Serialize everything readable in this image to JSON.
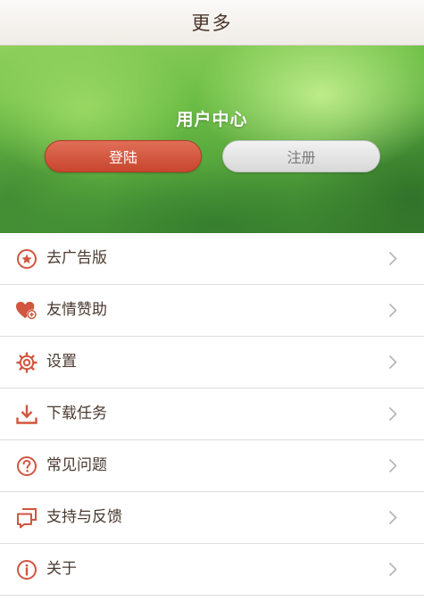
{
  "header": {
    "title": "更多"
  },
  "user_center": {
    "title": "用户中心",
    "login_label": "登陆",
    "register_label": "注册"
  },
  "menu": {
    "items": [
      {
        "label": "去广告版",
        "icon": "star-badge-icon"
      },
      {
        "label": "友情赞助",
        "icon": "heart-plus-icon"
      },
      {
        "label": "设置",
        "icon": "gear-icon"
      },
      {
        "label": "下载任务",
        "icon": "download-icon"
      },
      {
        "label": "常见问题",
        "icon": "question-icon"
      },
      {
        "label": "支持与反馈",
        "icon": "feedback-icon"
      },
      {
        "label": "关于",
        "icon": "info-icon"
      }
    ]
  },
  "colors": {
    "accent": "#d0563f",
    "text": "#4a3a30",
    "chevron": "#b8b8b8"
  }
}
